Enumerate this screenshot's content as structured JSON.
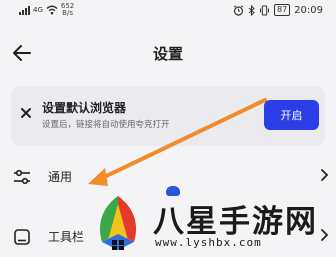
{
  "status_bar": {
    "network_type": "4G",
    "net_speed_value": "652",
    "net_speed_unit": "B/s",
    "battery": "87",
    "time": "20:09"
  },
  "header": {
    "title": "设置"
  },
  "banner": {
    "title": "设置默认浏览器",
    "description": "设置后，链接将自动使用夸克打开",
    "button_label": "开启"
  },
  "settings": {
    "items": [
      {
        "label": "通用"
      },
      {
        "label": "工具栏"
      }
    ]
  },
  "watermark": {
    "brand": "八星手游网",
    "url": "www.lyshbx.com"
  },
  "colors": {
    "accent": "#2b3de6",
    "annotation_arrow": "#f08c2a",
    "background": "#f4f4f6",
    "card": "#ebebef"
  }
}
